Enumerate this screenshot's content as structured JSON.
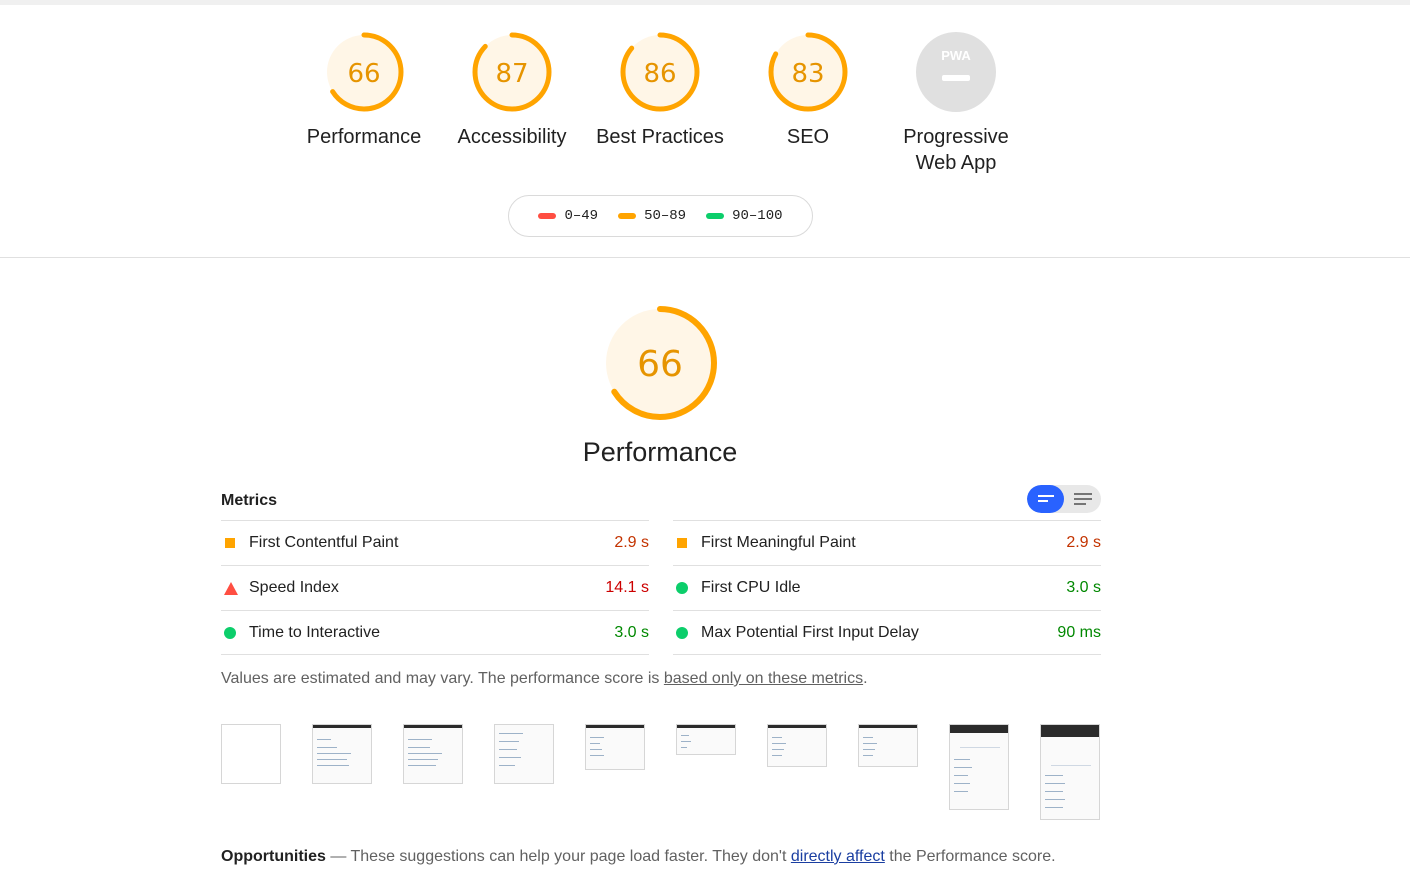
{
  "colors": {
    "average": "#ffa400",
    "average_bg": "#fff6e7",
    "fail": "#ff4e42",
    "pass": "#0cce6b",
    "na": "#e0e0e0",
    "toggle_active": "#2962ff"
  },
  "categories": [
    {
      "id": "performance",
      "label": "Performance",
      "score": "66",
      "fraction": 0.66
    },
    {
      "id": "accessibility",
      "label": "Accessibility",
      "score": "87",
      "fraction": 0.87
    },
    {
      "id": "best-practices",
      "label": "Best Practices",
      "score": "86",
      "fraction": 0.86
    },
    {
      "id": "seo",
      "label": "SEO",
      "score": "83",
      "fraction": 0.83
    },
    {
      "id": "pwa",
      "label_line1": "Progressive",
      "label_line2": "Web App",
      "badge_text": "PWA"
    }
  ],
  "legend": [
    {
      "range": "0–49",
      "color": "#ff4e42"
    },
    {
      "range": "50–89",
      "color": "#ffa400"
    },
    {
      "range": "90–100",
      "color": "#0cce6b"
    }
  ],
  "performance": {
    "score": "66",
    "fraction": 0.66,
    "title": "Performance"
  },
  "metrics": {
    "title": "Metrics",
    "left": [
      {
        "label": "First Contentful Paint",
        "value": "2.9 s",
        "status": "average",
        "icon": "square-icon"
      },
      {
        "label": "Speed Index",
        "value": "14.1 s",
        "status": "fail",
        "icon": "triangle-icon"
      },
      {
        "label": "Time to Interactive",
        "value": "3.0 s",
        "status": "pass",
        "icon": "circle-icon"
      }
    ],
    "right": [
      {
        "label": "First Meaningful Paint",
        "value": "2.9 s",
        "status": "average",
        "icon": "square-icon"
      },
      {
        "label": "First CPU Idle",
        "value": "3.0 s",
        "status": "pass",
        "icon": "circle-icon"
      },
      {
        "label": "Max Potential First Input Delay",
        "value": "90 ms",
        "status": "pass",
        "icon": "circle-icon"
      }
    ]
  },
  "disclaimer": {
    "text": "Values are estimated and may vary. The performance score is ",
    "link": "based only on these metrics",
    "end": "."
  },
  "opportunities": {
    "title": "Opportunities",
    "text": " — These suggestions can help your page load faster. They don't ",
    "link": "directly affect",
    "end": " the Performance score."
  }
}
